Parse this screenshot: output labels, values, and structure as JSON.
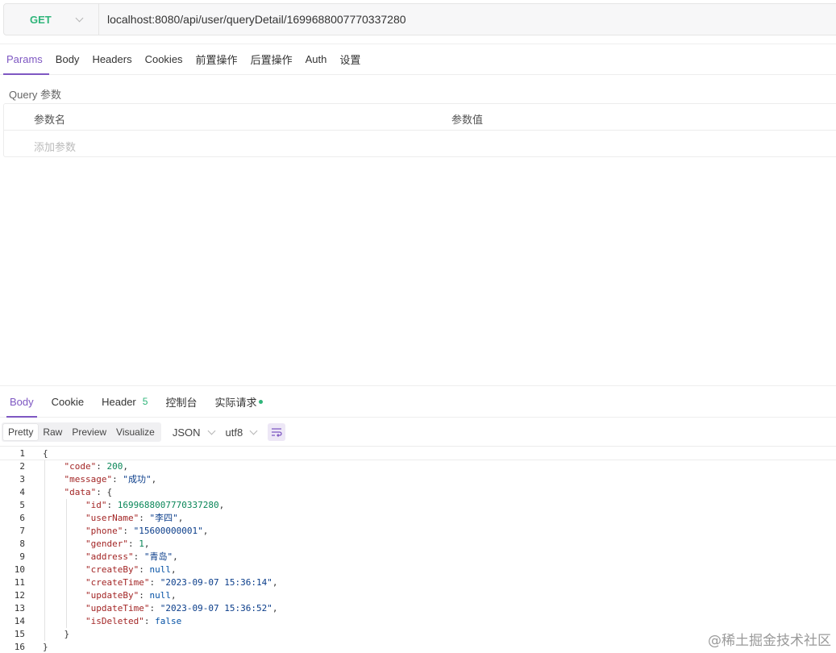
{
  "request": {
    "method": "GET",
    "url": "localhost:8080/api/user/queryDetail/1699688007770337280"
  },
  "request_tabs": [
    "Params",
    "Body",
    "Headers",
    "Cookies",
    "前置操作",
    "后置操作",
    "Auth",
    "设置"
  ],
  "params": {
    "title": "Query 参数",
    "col_name": "参数名",
    "col_value": "参数值",
    "add_placeholder": "添加参数"
  },
  "response_tabs": {
    "body": "Body",
    "cookie": "Cookie",
    "header": "Header",
    "header_count": "5",
    "console": "控制台",
    "actual": "实际请求"
  },
  "format": {
    "modes": [
      "Pretty",
      "Raw",
      "Preview",
      "Visualize"
    ],
    "active": "Pretty",
    "type": "JSON",
    "encoding": "utf8"
  },
  "code_lines": [
    {
      "n": "1",
      "indent": 0,
      "parts": [
        [
          "p",
          "{"
        ]
      ]
    },
    {
      "n": "2",
      "indent": 1,
      "parts": [
        [
          "k",
          "\"code\""
        ],
        [
          "p",
          ": "
        ],
        [
          "n",
          "200"
        ],
        [
          "p",
          ","
        ]
      ]
    },
    {
      "n": "3",
      "indent": 1,
      "parts": [
        [
          "k",
          "\"message\""
        ],
        [
          "p",
          ": "
        ],
        [
          "s",
          "\"成功\""
        ],
        [
          "p",
          ","
        ]
      ]
    },
    {
      "n": "4",
      "indent": 1,
      "parts": [
        [
          "k",
          "\"data\""
        ],
        [
          "p",
          ": {"
        ]
      ]
    },
    {
      "n": "5",
      "indent": 2,
      "parts": [
        [
          "k",
          "\"id\""
        ],
        [
          "p",
          ": "
        ],
        [
          "n",
          "1699688007770337280"
        ],
        [
          "p",
          ","
        ]
      ]
    },
    {
      "n": "6",
      "indent": 2,
      "parts": [
        [
          "k",
          "\"userName\""
        ],
        [
          "p",
          ": "
        ],
        [
          "s",
          "\"李四\""
        ],
        [
          "p",
          ","
        ]
      ]
    },
    {
      "n": "7",
      "indent": 2,
      "parts": [
        [
          "k",
          "\"phone\""
        ],
        [
          "p",
          ": "
        ],
        [
          "s",
          "\"15600000001\""
        ],
        [
          "p",
          ","
        ]
      ]
    },
    {
      "n": "8",
      "indent": 2,
      "parts": [
        [
          "k",
          "\"gender\""
        ],
        [
          "p",
          ": "
        ],
        [
          "n",
          "1"
        ],
        [
          "p",
          ","
        ]
      ]
    },
    {
      "n": "9",
      "indent": 2,
      "parts": [
        [
          "k",
          "\"address\""
        ],
        [
          "p",
          ": "
        ],
        [
          "s",
          "\"青岛\""
        ],
        [
          "p",
          ","
        ]
      ]
    },
    {
      "n": "10",
      "indent": 2,
      "parts": [
        [
          "k",
          "\"createBy\""
        ],
        [
          "p",
          ": "
        ],
        [
          "kw",
          "null"
        ],
        [
          "p",
          ","
        ]
      ]
    },
    {
      "n": "11",
      "indent": 2,
      "parts": [
        [
          "k",
          "\"createTime\""
        ],
        [
          "p",
          ": "
        ],
        [
          "s",
          "\"2023-09-07 15:36:14\""
        ],
        [
          "p",
          ","
        ]
      ]
    },
    {
      "n": "12",
      "indent": 2,
      "parts": [
        [
          "k",
          "\"updateBy\""
        ],
        [
          "p",
          ": "
        ],
        [
          "kw",
          "null"
        ],
        [
          "p",
          ","
        ]
      ]
    },
    {
      "n": "13",
      "indent": 2,
      "parts": [
        [
          "k",
          "\"updateTime\""
        ],
        [
          "p",
          ": "
        ],
        [
          "s",
          "\"2023-09-07 15:36:52\""
        ],
        [
          "p",
          ","
        ]
      ]
    },
    {
      "n": "14",
      "indent": 2,
      "parts": [
        [
          "k",
          "\"isDeleted\""
        ],
        [
          "p",
          ": "
        ],
        [
          "kw",
          "false"
        ]
      ]
    },
    {
      "n": "15",
      "indent": 1,
      "parts": [
        [
          "p",
          "}"
        ]
      ]
    },
    {
      "n": "16",
      "indent": 0,
      "parts": [
        [
          "p",
          "}"
        ]
      ]
    }
  ],
  "watermark": "@稀土掘金技术社区",
  "colors": {
    "accent": "#7e57c2",
    "method_get": "#2fb57a"
  }
}
